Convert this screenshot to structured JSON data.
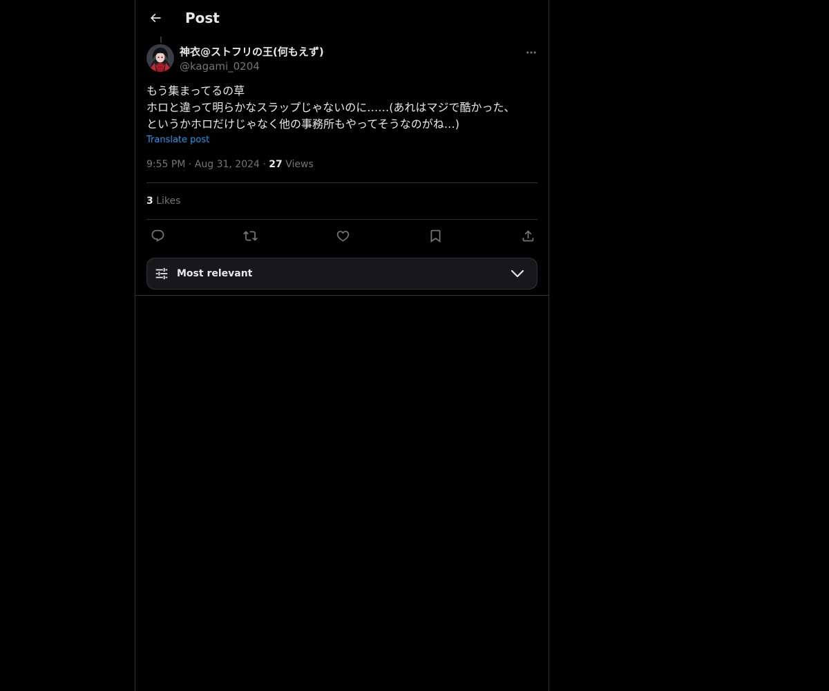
{
  "header": {
    "title": "Post",
    "back_icon": "arrow-left-icon"
  },
  "author": {
    "display_name": "神衣@ストフリの王(何もえず)",
    "handle": "@kagami_0204",
    "avatar_icon": "avatar-image"
  },
  "post": {
    "lines": [
      "もう集まってるの草",
      "ホロと違って明らかなスラップじゃないのに……(あれはマジで酷かった、",
      "というかホロだけじゃなく他の事務所もやってそうなのがね…)"
    ],
    "translate_label": "Translate post",
    "time": "9:55 PM",
    "date": "Aug 31, 2024",
    "views_count": "27",
    "views_label": "Views",
    "likes_count": "3",
    "likes_label": "Likes"
  },
  "actions": {
    "reply_icon": "reply-icon",
    "repost_icon": "repost-icon",
    "like_icon": "heart-icon",
    "bookmark_icon": "bookmark-icon",
    "share_icon": "share-icon"
  },
  "sort": {
    "label": "Most relevant"
  },
  "colors": {
    "background": "#000000",
    "text_primary": "#e7e9ea",
    "text_secondary": "#71767b",
    "accent": "#1d9bf0",
    "border": "#2f3336"
  }
}
